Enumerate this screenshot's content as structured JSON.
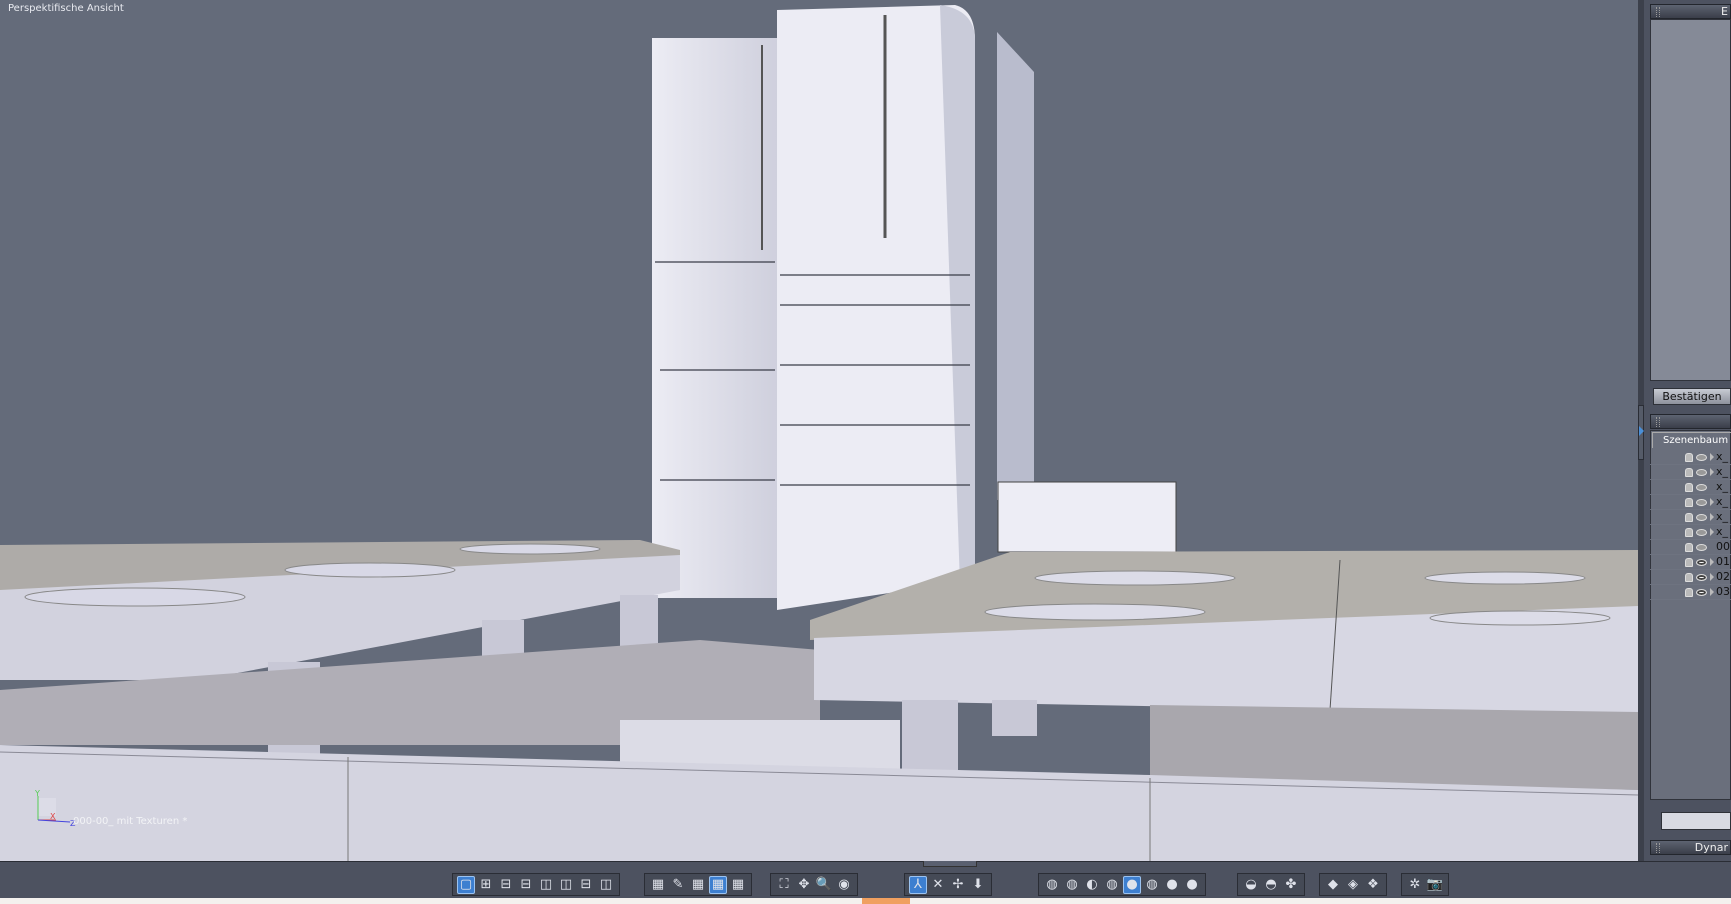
{
  "viewport": {
    "title": "Perspektifische Ansicht",
    "file_label": "000-00_ mit Texturen *",
    "axes": {
      "y": "Y",
      "x": "X",
      "z": "Z"
    },
    "background": "#646b7a"
  },
  "right_panel": {
    "top_header": "E",
    "confirm_button": "Bestätigen",
    "scene_tree_tab": "Szenenbaum",
    "scene_tree": [
      {
        "name": "x_",
        "visible": false,
        "expandable": true
      },
      {
        "name": "x_",
        "visible": false,
        "expandable": true
      },
      {
        "name": "x_",
        "visible": false,
        "expandable": false
      },
      {
        "name": "x_",
        "visible": false,
        "expandable": true
      },
      {
        "name": "x_",
        "visible": false,
        "expandable": true
      },
      {
        "name": "x_",
        "visible": false,
        "expandable": true
      },
      {
        "name": "00",
        "visible": false,
        "expandable": false
      },
      {
        "name": "01",
        "visible": true,
        "expandable": true
      },
      {
        "name": "02",
        "visible": true,
        "expandable": true
      },
      {
        "name": "03",
        "visible": true,
        "expandable": true
      }
    ],
    "bottom_header": "Dynar"
  },
  "toolbar": {
    "accent": "#3d7fd0",
    "groups": [
      {
        "name": "layout",
        "icons": [
          {
            "n": "single-view-icon",
            "g": "▢",
            "sel": true
          },
          {
            "n": "quad-view-icon",
            "g": "⊞"
          },
          {
            "n": "three-view-top-icon",
            "g": "⊟"
          },
          {
            "n": "three-view-bottom-icon",
            "g": "⊟"
          },
          {
            "n": "three-view-left-icon",
            "g": "◫"
          },
          {
            "n": "three-view-right-icon",
            "g": "◫"
          },
          {
            "n": "two-view-horizontal-icon",
            "g": "⊟"
          },
          {
            "n": "two-view-vertical-icon",
            "g": "◫"
          }
        ]
      },
      {
        "name": "grid",
        "icons": [
          {
            "n": "grid-edit-icon",
            "g": "▦"
          },
          {
            "n": "grid-snap-icon",
            "g": "✎"
          },
          {
            "n": "grid-red-icon",
            "g": "▦"
          },
          {
            "n": "grid-blue-icon",
            "g": "▦",
            "sel": true
          },
          {
            "n": "grid-green-icon",
            "g": "▦"
          }
        ]
      },
      {
        "name": "navigate",
        "icons": [
          {
            "n": "zoom-extents-icon",
            "g": "⛶"
          },
          {
            "n": "pan-icon",
            "g": "✥"
          },
          {
            "n": "zoom-icon",
            "g": "🔍"
          },
          {
            "n": "look-icon",
            "g": "◉"
          }
        ]
      },
      {
        "name": "transform",
        "icons": [
          {
            "n": "axis-icon",
            "g": "⅄",
            "sel": true
          },
          {
            "n": "move-icon",
            "g": "✕"
          },
          {
            "n": "rotate-icon",
            "g": "✢"
          },
          {
            "n": "drop-icon",
            "g": "⬇"
          }
        ]
      },
      {
        "name": "shading",
        "icons": [
          {
            "n": "wireframe-icon",
            "g": "◍"
          },
          {
            "n": "wireframe-hidden-icon",
            "g": "◍"
          },
          {
            "n": "flat-shade-icon",
            "g": "◐"
          },
          {
            "n": "shaded-wire-icon",
            "g": "◍"
          },
          {
            "n": "smooth-shade-icon",
            "g": "●",
            "sel": true
          },
          {
            "n": "smooth-wire-icon",
            "g": "◍"
          },
          {
            "n": "gray-sphere-icon",
            "g": "●"
          },
          {
            "n": "white-sphere-icon",
            "g": "●"
          }
        ]
      },
      {
        "name": "objects",
        "icons": [
          {
            "n": "object-select-icon",
            "g": "◒"
          },
          {
            "n": "object-group-icon",
            "g": "◓"
          },
          {
            "n": "object-multi-icon",
            "g": "✤"
          }
        ]
      },
      {
        "name": "primitives",
        "icons": [
          {
            "n": "cube-icon",
            "g": "◆"
          },
          {
            "n": "box-icon",
            "g": "◈"
          },
          {
            "n": "shape-icon",
            "g": "❖"
          }
        ]
      },
      {
        "name": "render",
        "icons": [
          {
            "n": "light-icon",
            "g": "✲"
          },
          {
            "n": "camera-icon",
            "g": "📷"
          }
        ]
      }
    ]
  }
}
